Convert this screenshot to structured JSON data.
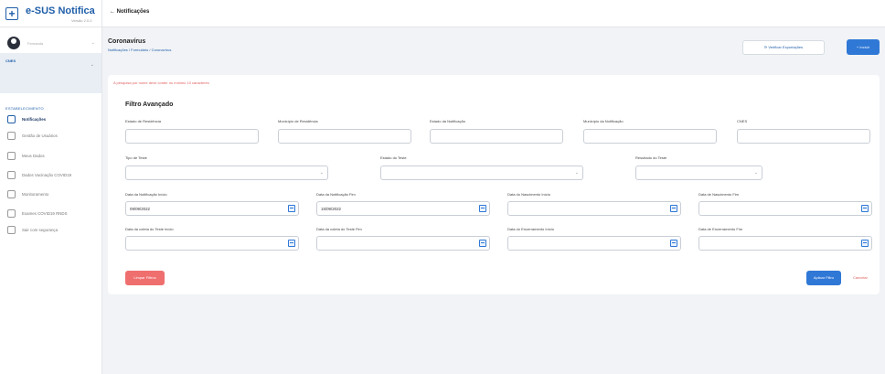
{
  "brand": {
    "name": "e-SUS Notifica",
    "subtitle": "Versão 2.0.0"
  },
  "topbar": {
    "back_label": "Notificações",
    "back_arrow": "←"
  },
  "sidebar": {
    "user_name": "Fernanda",
    "cnes_label": "CNES",
    "section_title": "ESTABELECIMENTO",
    "items": [
      {
        "label": "Notificações",
        "icon": "document-icon",
        "active": true
      },
      {
        "label": "Gestão de Usuários",
        "icon": "users-icon",
        "active": false
      },
      {
        "label": "Meus Dados",
        "icon": "id-card-icon",
        "active": false
      },
      {
        "label": "Dados Vacinação COVID19",
        "icon": "syringe-icon",
        "active": false
      },
      {
        "label": "Monitoramento",
        "icon": "monitor-icon",
        "active": false
      },
      {
        "label": "Exames COVID19 RNDS",
        "icon": "lab-icon",
        "active": false
      },
      {
        "label": "Sair com segurança",
        "icon": "logout-icon",
        "active": false
      }
    ]
  },
  "header": {
    "title": "Coronavírus",
    "breadcrumb": "Notificações / Formulário / Coronavírus",
    "verify_button": "Verificar Exportações",
    "include_button": "Incluir"
  },
  "form": {
    "warning": "A pesquisa por nome deve conter no mínimo 10 caracteres",
    "title": "Filtro Avançado",
    "row1": [
      {
        "label": "Estado de Residência",
        "value": ""
      },
      {
        "label": "Município de Residência",
        "value": ""
      },
      {
        "label": "Estado da Notificação",
        "value": ""
      },
      {
        "label": "Município da Notificação",
        "value": ""
      },
      {
        "label": "CNES",
        "value": ""
      }
    ],
    "row2": [
      {
        "label": "Tipo de Teste",
        "value": ""
      },
      {
        "label": "Estado do Teste",
        "value": ""
      },
      {
        "label": "Resultado do Teste",
        "value": ""
      }
    ],
    "row3": [
      {
        "label": "Data da Notificação Início",
        "value": "09/09/2022"
      },
      {
        "label": "Data da Notificação Fim",
        "value": "15/09/2022"
      },
      {
        "label": "Data do Nascimento Início",
        "value": ""
      },
      {
        "label": "Data de Nascimento Fim",
        "value": ""
      }
    ],
    "row4": [
      {
        "label": "Data da coleta do Teste Início",
        "value": ""
      },
      {
        "label": "Data da coleta do Teste Fim",
        "value": ""
      },
      {
        "label": "Data do Encerramento Início",
        "value": ""
      },
      {
        "label": "Data de Encerramento Fim",
        "value": ""
      }
    ],
    "clear_button": "Limpar Filtros",
    "apply_button": "Aplicar Filtro",
    "cancel_button": "Cancelar"
  },
  "colors": {
    "primary": "#2f78d6",
    "danger": "#ef6f6f",
    "brand": "#1f5ea8"
  }
}
